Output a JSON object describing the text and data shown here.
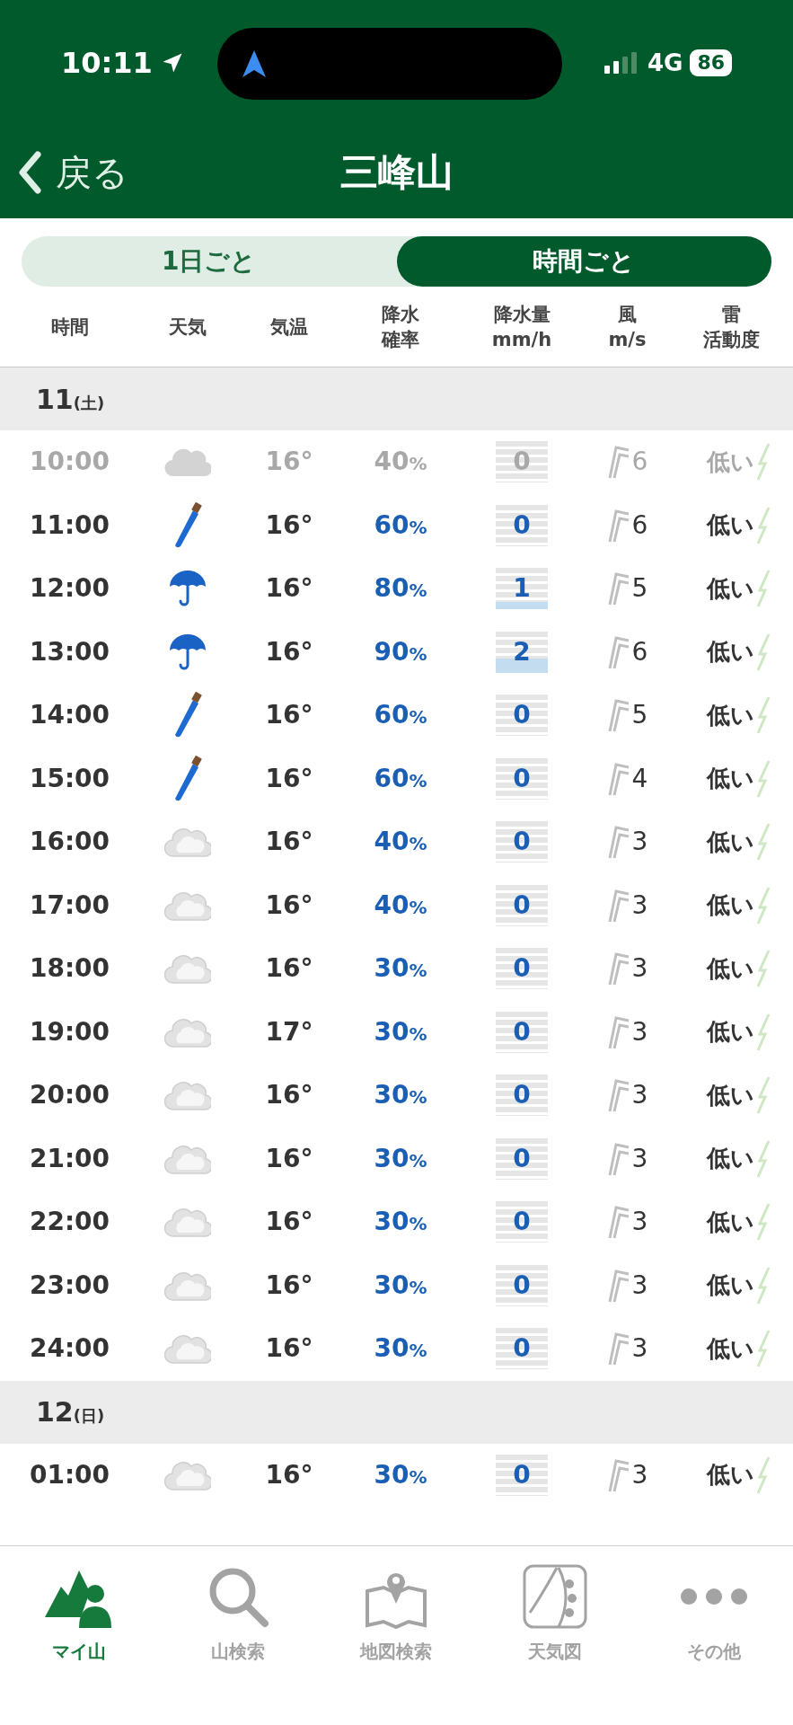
{
  "status_bar": {
    "time": "10:11",
    "network": "4G",
    "battery": "86"
  },
  "header": {
    "back": "戻る",
    "title": "三峰山"
  },
  "tabs": [
    {
      "label": "1日ごと",
      "selected": false
    },
    {
      "label": "時間ごと",
      "selected": true
    }
  ],
  "columns": [
    [
      "時間"
    ],
    [
      "天気"
    ],
    [
      "気温"
    ],
    [
      "降水",
      "確率"
    ],
    [
      "降水量",
      "mm/h"
    ],
    [
      "風",
      "m/s"
    ],
    [
      "雷",
      "活動度"
    ]
  ],
  "days": [
    {
      "day": "11",
      "weekday": "(土)",
      "rows": [
        {
          "time": "10:00",
          "kind": "cloud",
          "temp": "16°",
          "pop": "40",
          "pop_unit": "%",
          "amount": "0",
          "wind": "6",
          "thunder": "低い",
          "past": true
        },
        {
          "time": "11:00",
          "kind": "closed-umbrella",
          "temp": "16°",
          "pop": "60",
          "pop_unit": "%",
          "amount": "0",
          "wind": "6",
          "thunder": "低い",
          "past": false
        },
        {
          "time": "12:00",
          "kind": "umbrella",
          "temp": "16°",
          "pop": "80",
          "pop_unit": "%",
          "amount": "1",
          "wind": "5",
          "thunder": "低い",
          "past": false
        },
        {
          "time": "13:00",
          "kind": "umbrella",
          "temp": "16°",
          "pop": "90",
          "pop_unit": "%",
          "amount": "2",
          "wind": "6",
          "thunder": "低い",
          "past": false
        },
        {
          "time": "14:00",
          "kind": "closed-umbrella",
          "temp": "16°",
          "pop": "60",
          "pop_unit": "%",
          "amount": "0",
          "wind": "5",
          "thunder": "低い",
          "past": false
        },
        {
          "time": "15:00",
          "kind": "closed-umbrella",
          "temp": "16°",
          "pop": "60",
          "pop_unit": "%",
          "amount": "0",
          "wind": "4",
          "thunder": "低い",
          "past": false
        },
        {
          "time": "16:00",
          "kind": "cloudy",
          "temp": "16°",
          "pop": "40",
          "pop_unit": "%",
          "amount": "0",
          "wind": "3",
          "thunder": "低い",
          "past": false
        },
        {
          "time": "17:00",
          "kind": "cloudy",
          "temp": "16°",
          "pop": "40",
          "pop_unit": "%",
          "amount": "0",
          "wind": "3",
          "thunder": "低い",
          "past": false
        },
        {
          "time": "18:00",
          "kind": "cloudy",
          "temp": "16°",
          "pop": "30",
          "pop_unit": "%",
          "amount": "0",
          "wind": "3",
          "thunder": "低い",
          "past": false
        },
        {
          "time": "19:00",
          "kind": "cloudy",
          "temp": "17°",
          "pop": "30",
          "pop_unit": "%",
          "amount": "0",
          "wind": "3",
          "thunder": "低い",
          "past": false
        },
        {
          "time": "20:00",
          "kind": "cloudy",
          "temp": "16°",
          "pop": "30",
          "pop_unit": "%",
          "amount": "0",
          "wind": "3",
          "thunder": "低い",
          "past": false
        },
        {
          "time": "21:00",
          "kind": "cloudy",
          "temp": "16°",
          "pop": "30",
          "pop_unit": "%",
          "amount": "0",
          "wind": "3",
          "thunder": "低い",
          "past": false
        },
        {
          "time": "22:00",
          "kind": "cloudy",
          "temp": "16°",
          "pop": "30",
          "pop_unit": "%",
          "amount": "0",
          "wind": "3",
          "thunder": "低い",
          "past": false
        },
        {
          "time": "23:00",
          "kind": "cloudy",
          "temp": "16°",
          "pop": "30",
          "pop_unit": "%",
          "amount": "0",
          "wind": "3",
          "thunder": "低い",
          "past": false
        },
        {
          "time": "24:00",
          "kind": "cloudy",
          "temp": "16°",
          "pop": "30",
          "pop_unit": "%",
          "amount": "0",
          "wind": "3",
          "thunder": "低い",
          "past": false
        }
      ]
    },
    {
      "day": "12",
      "weekday": "(日)",
      "rows": [
        {
          "time": "01:00",
          "kind": "cloudy",
          "temp": "16°",
          "pop": "30",
          "pop_unit": "%",
          "amount": "0",
          "wind": "3",
          "thunder": "低い",
          "past": false
        }
      ]
    }
  ],
  "nav": [
    {
      "label": "マイ山",
      "kind": "mountain-person",
      "selected": true
    },
    {
      "label": "山検索",
      "kind": "search",
      "selected": false
    },
    {
      "label": "地図検索",
      "kind": "map",
      "selected": false
    },
    {
      "label": "天気図",
      "kind": "weather-map",
      "selected": false
    },
    {
      "label": "その他",
      "kind": "more",
      "selected": false
    }
  ]
}
